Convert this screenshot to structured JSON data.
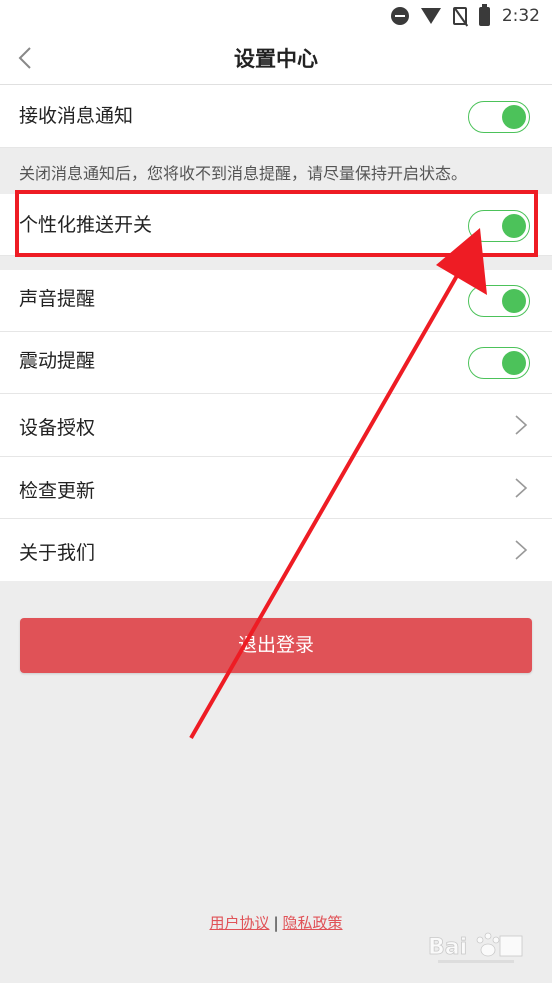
{
  "status_bar": {
    "time": "2:32",
    "icons": [
      "do-not-disturb-icon",
      "wifi-icon",
      "no-sim-icon",
      "battery-charging-icon"
    ]
  },
  "header": {
    "title": "设置中心",
    "back_icon": "chevron-left-icon"
  },
  "settings": {
    "notification": {
      "label": "接收消息通知",
      "enabled": true
    },
    "note": "关闭消息通知后，您将收不到消息提醒，请尽量保持开启状态。",
    "personalized_push": {
      "label": "个性化推送开关",
      "enabled": true
    },
    "sound": {
      "label": "声音提醒",
      "enabled": true
    },
    "vibration": {
      "label": "震动提醒",
      "enabled": true
    },
    "device_auth": {
      "label": "设备授权"
    },
    "check_update": {
      "label": "检查更新"
    },
    "about": {
      "label": "关于我们"
    }
  },
  "logout": {
    "label": "退出登录"
  },
  "footer": {
    "user_agreement": "用户协议",
    "separator": "|",
    "privacy_policy": "隐私政策"
  },
  "colors": {
    "toggle_on": "#4cc25a",
    "logout_button": "#e05257",
    "annotation_red": "#ee1c24",
    "background": "#ededed"
  }
}
